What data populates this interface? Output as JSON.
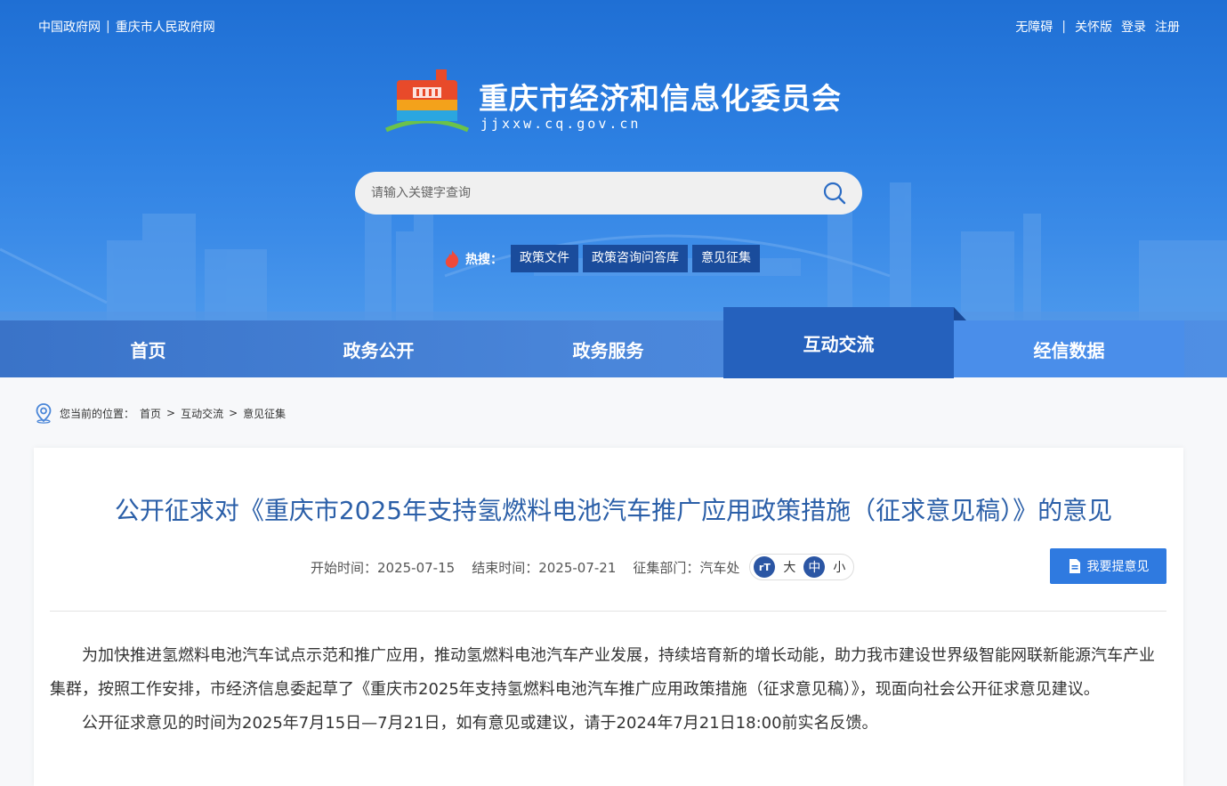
{
  "topbar": {
    "left": [
      "中国政府网",
      "重庆市人民政府网"
    ],
    "right": [
      "无障碍",
      "关怀版",
      "登录",
      "注册"
    ]
  },
  "site": {
    "title": "重庆市经济和信息化委员会",
    "domain": "jjxxw.cq.gov.cn"
  },
  "search": {
    "placeholder": "请输入关键字查询"
  },
  "hot": {
    "label": "热搜：",
    "tags": [
      "政策文件",
      "政策咨询问答库",
      "意见征集"
    ]
  },
  "nav": {
    "items": [
      "首页",
      "政务公开",
      "政务服务",
      "互动交流",
      "经信数据"
    ],
    "active": "互动交流"
  },
  "breadcrumb": {
    "label": "您当前的位置：",
    "items": [
      "首页",
      "互动交流",
      "意见征集"
    ]
  },
  "article": {
    "title": "公开征求对《重庆市2025年支持氢燃料电池汽车推广应用政策措施（征求意见稿）》的意见",
    "meta": {
      "start": "开始时间：2025-07-15",
      "end": "结束时间：2025-07-21",
      "dept": "征集部门：汽车处"
    },
    "fontsize": {
      "icon": "rT",
      "options": [
        "大",
        "中",
        "小"
      ],
      "selected": "中"
    },
    "feedback_label": "我要提意见",
    "paragraphs": [
      "为加快推进氢燃料电池汽车试点示范和推广应用，推动氢燃料电池汽车产业发展，持续培育新的增长动能，助力我市建设世界级智能网联新能源汽车产业集群，按照工作安排，市经济信息委起草了《重庆市2025年支持氢燃料电池汽车推广应用政策措施（征求意见稿）》，现面向社会公开征求意见建议。",
      "公开征求意见的时间为2025年7月15日—7月21日，如有意见或建议，请于2024年7月21日18:00前实名反馈。"
    ]
  },
  "colors": {
    "hero": "#2d80e2",
    "nav_active": "#2561bd",
    "title": "#2b5fa8",
    "button": "#2f7ae0",
    "hot_tag": "#1a4c9c"
  },
  "icons": [
    "logo-emblem",
    "search-icon",
    "flame-icon",
    "location-pin-icon",
    "font-size-icon",
    "document-edit-icon"
  ]
}
